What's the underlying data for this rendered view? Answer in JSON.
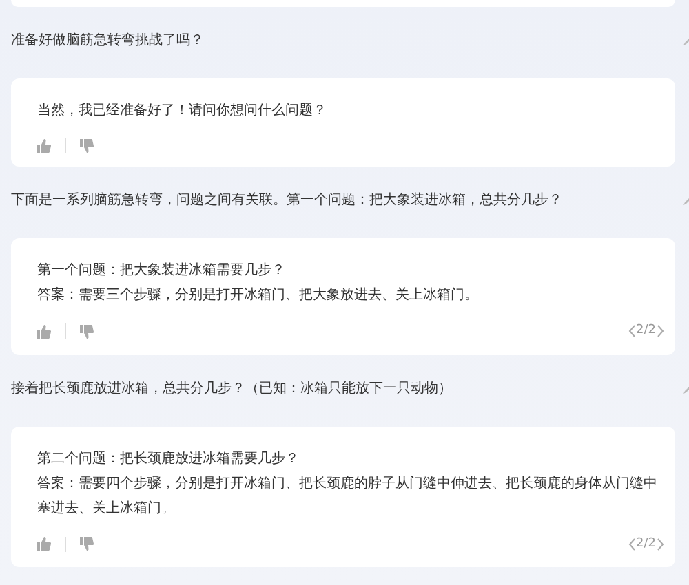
{
  "conversation": [
    {
      "question": "准备好做脑筋急转弯挑战了吗？",
      "answer_lines": [
        "当然，我已经准备好了！请问你想问什么问题？"
      ]
    },
    {
      "question": "下面是一系列脑筋急转弯，问题之间有关联。第一个问题：把大象装进冰箱，总共分几步？",
      "answer_lines": [
        "第一个问题：把大象装进冰箱需要几步？",
        "答案：需要三个步骤，分别是打开冰箱门、把大象放进去、关上冰箱门。"
      ],
      "pager": "2/2"
    },
    {
      "question": "接着把长颈鹿放进冰箱，总共分几步？（已知：冰箱只能放下一只动物）",
      "answer_lines": [
        "第二个问题：把长颈鹿放进冰箱需要几步？",
        "答案：需要四个步骤，分别是打开冰箱门、把长颈鹿的脖子从门缝中伸进去、把长颈鹿的身体从门缝中塞进去、关上冰箱门。"
      ],
      "pager": "2/2"
    }
  ]
}
